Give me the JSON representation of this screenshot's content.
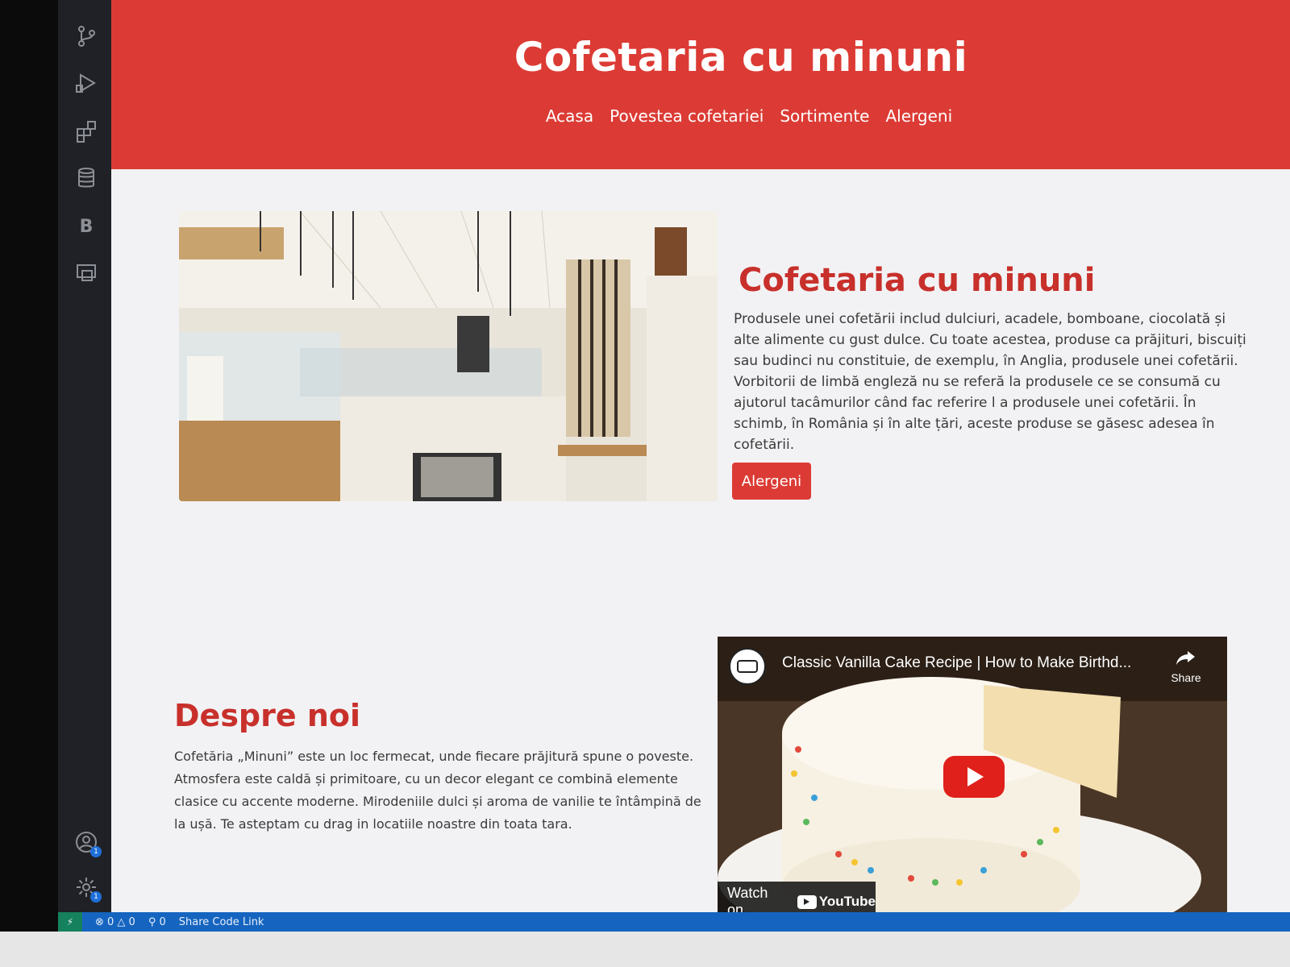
{
  "header": {
    "site_title": "Cofetaria cu minuni",
    "nav": [
      "Acasa",
      "Povestea cofetariei",
      "Sortimente",
      "Alergeni"
    ]
  },
  "hero": {
    "title": "Cofetaria cu minuni",
    "text": "Produsele unei cofetării includ dulciuri, acadele, bomboane, ciocolată și alte alimente cu gust dulce. Cu toate acestea, produse ca prăjituri, biscuiți sau budinci nu constituie, de exemplu, în Anglia, produsele unei cofetării. Vorbitorii de limbă engleză nu se referă la produsele ce se consumă cu ajutorul tacâmurilor când fac referire l a produsele unei cofetării. În schimb, în România și în alte țări, aceste produse se găsesc adesea în cofetării.",
    "button_label": "Alergeni"
  },
  "about": {
    "title": "Despre noi",
    "text": "Cofetăria „Minuni” este un loc fermecat, unde fiecare prăjitură spune o poveste. Atmosfera este caldă și primitoare, cu un decor elegant ce combină elemente clasice cu accente moderne. Mirodeniile dulci și aroma de vanilie te întâmpină de la ușă. Te asteptam cu drag in locatiile noastre din toata tara."
  },
  "video": {
    "title": "Classic Vanilla Cake Recipe | How to Make Birthd...",
    "share_label": "Share",
    "watch_on": "Watch on",
    "youtube": "YouTube"
  },
  "statusbar": {
    "remote": "⚡",
    "problems": "⊗ 0 △ 0",
    "ports": "⚲ 0",
    "share": "Share Code Link"
  },
  "activity_bar": {
    "icons": [
      "source-control-icon",
      "run-debug-icon",
      "extensions-icon",
      "database-icon",
      "bootstrap-icon",
      "remote-explorer-icon",
      "account-icon",
      "settings-gear-icon"
    ],
    "b_letter": "B",
    "badge": "1"
  },
  "colors": {
    "header_red": "#dc3b35",
    "title_red": "#c8302b",
    "statusbar_blue": "#1565c0",
    "remote_green": "#16825d"
  }
}
